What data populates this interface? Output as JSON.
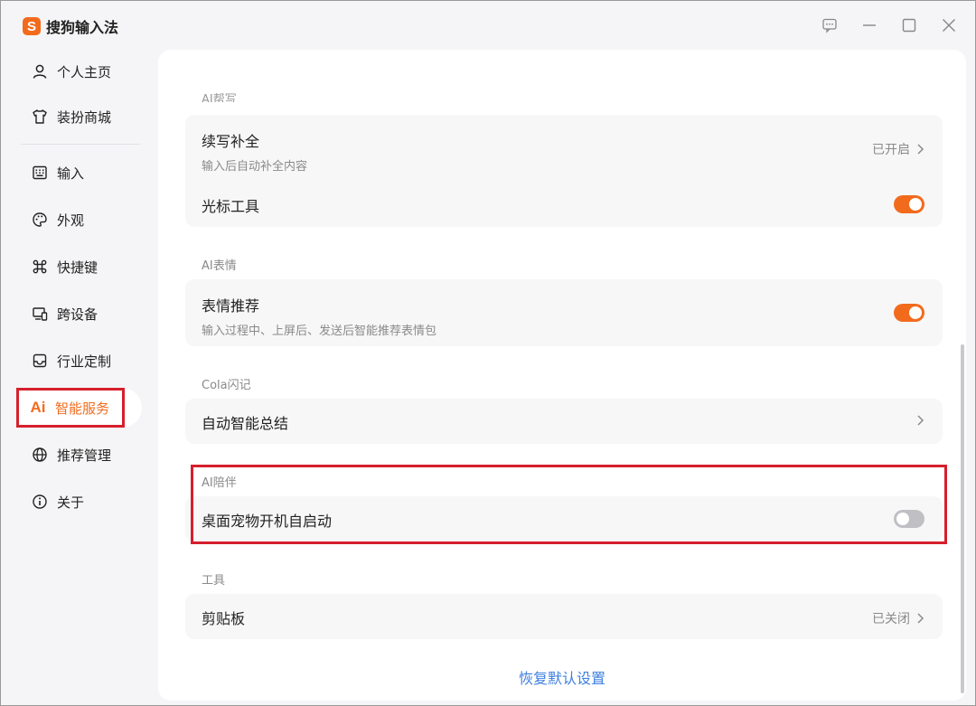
{
  "app": {
    "logo_letter": "S",
    "title": "搜狗输入法",
    "brand_color": "#f26b1d"
  },
  "window_controls": {
    "feedback_icon": "feedback-icon",
    "minimize_icon": "minimize-icon",
    "maximize_icon": "maximize-icon",
    "close_icon": "close-icon"
  },
  "sidebar": {
    "items": [
      {
        "label": "个人主页",
        "icon": "user-icon"
      },
      {
        "label": "装扮商城",
        "icon": "tshirt-icon"
      },
      {
        "label": "输入",
        "icon": "keyboard-icon"
      },
      {
        "label": "外观",
        "icon": "palette-icon"
      },
      {
        "label": "快捷键",
        "icon": "command-icon"
      },
      {
        "label": "跨设备",
        "icon": "devices-icon"
      },
      {
        "label": "行业定制",
        "icon": "tray-icon"
      },
      {
        "label": "智能服务",
        "icon": "ai-icon",
        "icon_text": "Ai",
        "active": true
      },
      {
        "label": "推荐管理",
        "icon": "globe-icon"
      },
      {
        "label": "关于",
        "icon": "info-icon"
      }
    ]
  },
  "main": {
    "cut_section_label": "AI帮写",
    "sections": [
      {
        "rows": [
          {
            "title": "续写补全",
            "subtitle": "输入后自动补全内容",
            "status": "已开启",
            "control": "link"
          },
          {
            "title": "光标工具",
            "control": "toggle",
            "toggle_on": true
          }
        ]
      },
      {
        "label": "AI表情",
        "rows": [
          {
            "title": "表情推荐",
            "subtitle": "输入过程中、上屏后、发送后智能推荐表情包",
            "control": "toggle",
            "toggle_on": true
          }
        ]
      },
      {
        "label": "Cola闪记",
        "rows": [
          {
            "title": "自动智能总结",
            "control": "link",
            "status": ""
          }
        ]
      },
      {
        "label": "AI陪伴",
        "rows": [
          {
            "title": "桌面宠物开机自启动",
            "control": "toggle",
            "toggle_on": false
          }
        ]
      },
      {
        "label": "工具",
        "rows": [
          {
            "title": "剪贴板",
            "status": "已关闭",
            "control": "link"
          }
        ]
      }
    ],
    "reset_label": "恢复默认设置"
  }
}
